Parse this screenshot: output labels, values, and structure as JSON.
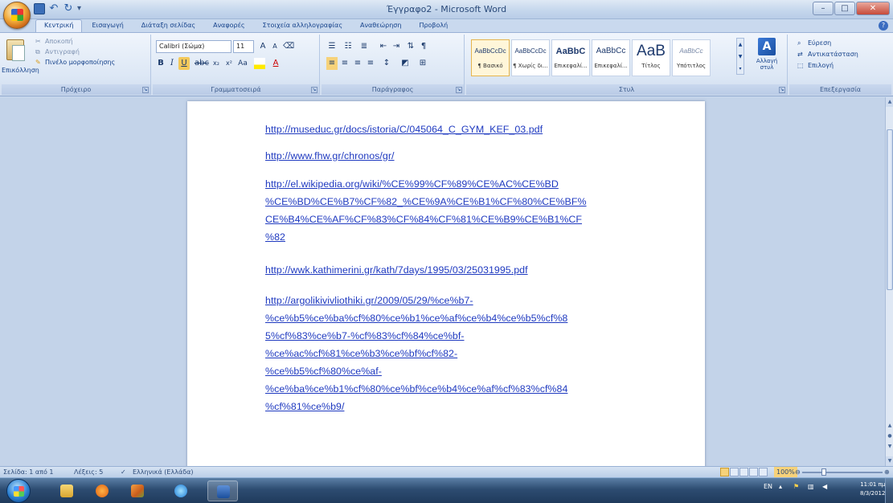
{
  "window": {
    "title": "Έγγραφο2 - Microsoft Word",
    "minimize": "–",
    "maximize": "□",
    "close": "✕"
  },
  "tabs": [
    "Κεντρική",
    "Εισαγωγή",
    "Διάταξη σελίδας",
    "Αναφορές",
    "Στοιχεία αλληλογραφίας",
    "Αναθεώρηση",
    "Προβολή"
  ],
  "ribbon": {
    "clipboard": {
      "label": "Πρόχειρο",
      "paste": "Επικόλληση",
      "cut": "Αποκοπή",
      "copy": "Αντιγραφή",
      "format_painter": "Πινέλο μορφοποίησης"
    },
    "font": {
      "label": "Γραμματοσειρά",
      "name": "Calibri (Σώμα)",
      "size": "11"
    },
    "paragraph": {
      "label": "Παράγραφος"
    },
    "styles": {
      "label": "Στυλ",
      "items": [
        {
          "sample": "AaBbCcDc",
          "name": "¶ Βασικό"
        },
        {
          "sample": "AaBbCcDc",
          "name": "¶ Χωρίς δι..."
        },
        {
          "sample": "AaBbC",
          "name": "Επικεφαλί..."
        },
        {
          "sample": "AaBbCc",
          "name": "Επικεφαλί..."
        },
        {
          "sample": "AaB",
          "name": "Τίτλος"
        },
        {
          "sample": "AaBbCc",
          "name": "Υπότιτλος"
        }
      ],
      "change": "Αλλαγή στυλ"
    },
    "editing": {
      "label": "Επεξεργασία",
      "find": "Εύρεση",
      "replace": "Αντικατάσταση",
      "select": "Επιλογή"
    }
  },
  "document": {
    "links": [
      "http://museduc.gr/docs/istoria/C/045064_C_GYM_KEF_03.pdf",
      "http://www.fhw.gr/chronos/gr/",
      "http://el.wikipedia.org/wiki/%CE%99%CF%89%CE%AC%CE%BD\n%CE%BD%CE%B7%CF%82_%CE%9A%CE%B1%CF%80%CE%BF%\nCE%B4%CE%AF%CF%83%CF%84%CF%81%CE%B9%CE%B1%CF\n%82",
      "http://wwk.kathimerini.gr/kath/7days/1995/03/25031995.pdf",
      "http://argolikivivliothiki.gr/2009/05/29/%ce%b7-\n%ce%b5%ce%ba%cf%80%ce%b1%ce%af%ce%b4%ce%b5%cf%8\n5%cf%83%ce%b7-%cf%83%cf%84%ce%bf-\n%ce%ac%cf%81%ce%b3%ce%bf%cf%82-\n%ce%b5%cf%80%ce%af-\n%ce%ba%ce%b1%cf%80%ce%bf%ce%b4%ce%af%cf%83%cf%84\n%cf%81%ce%b9/"
    ]
  },
  "statusbar": {
    "page": "Σελίδα: 1 από 1",
    "words": "Λέξεις: 5",
    "language": "Ελληνικά (Ελλάδα)",
    "zoom": "100%"
  },
  "taskbar": {
    "lang": "EN",
    "time": "11:01 πμ",
    "date": "8/3/2012"
  }
}
